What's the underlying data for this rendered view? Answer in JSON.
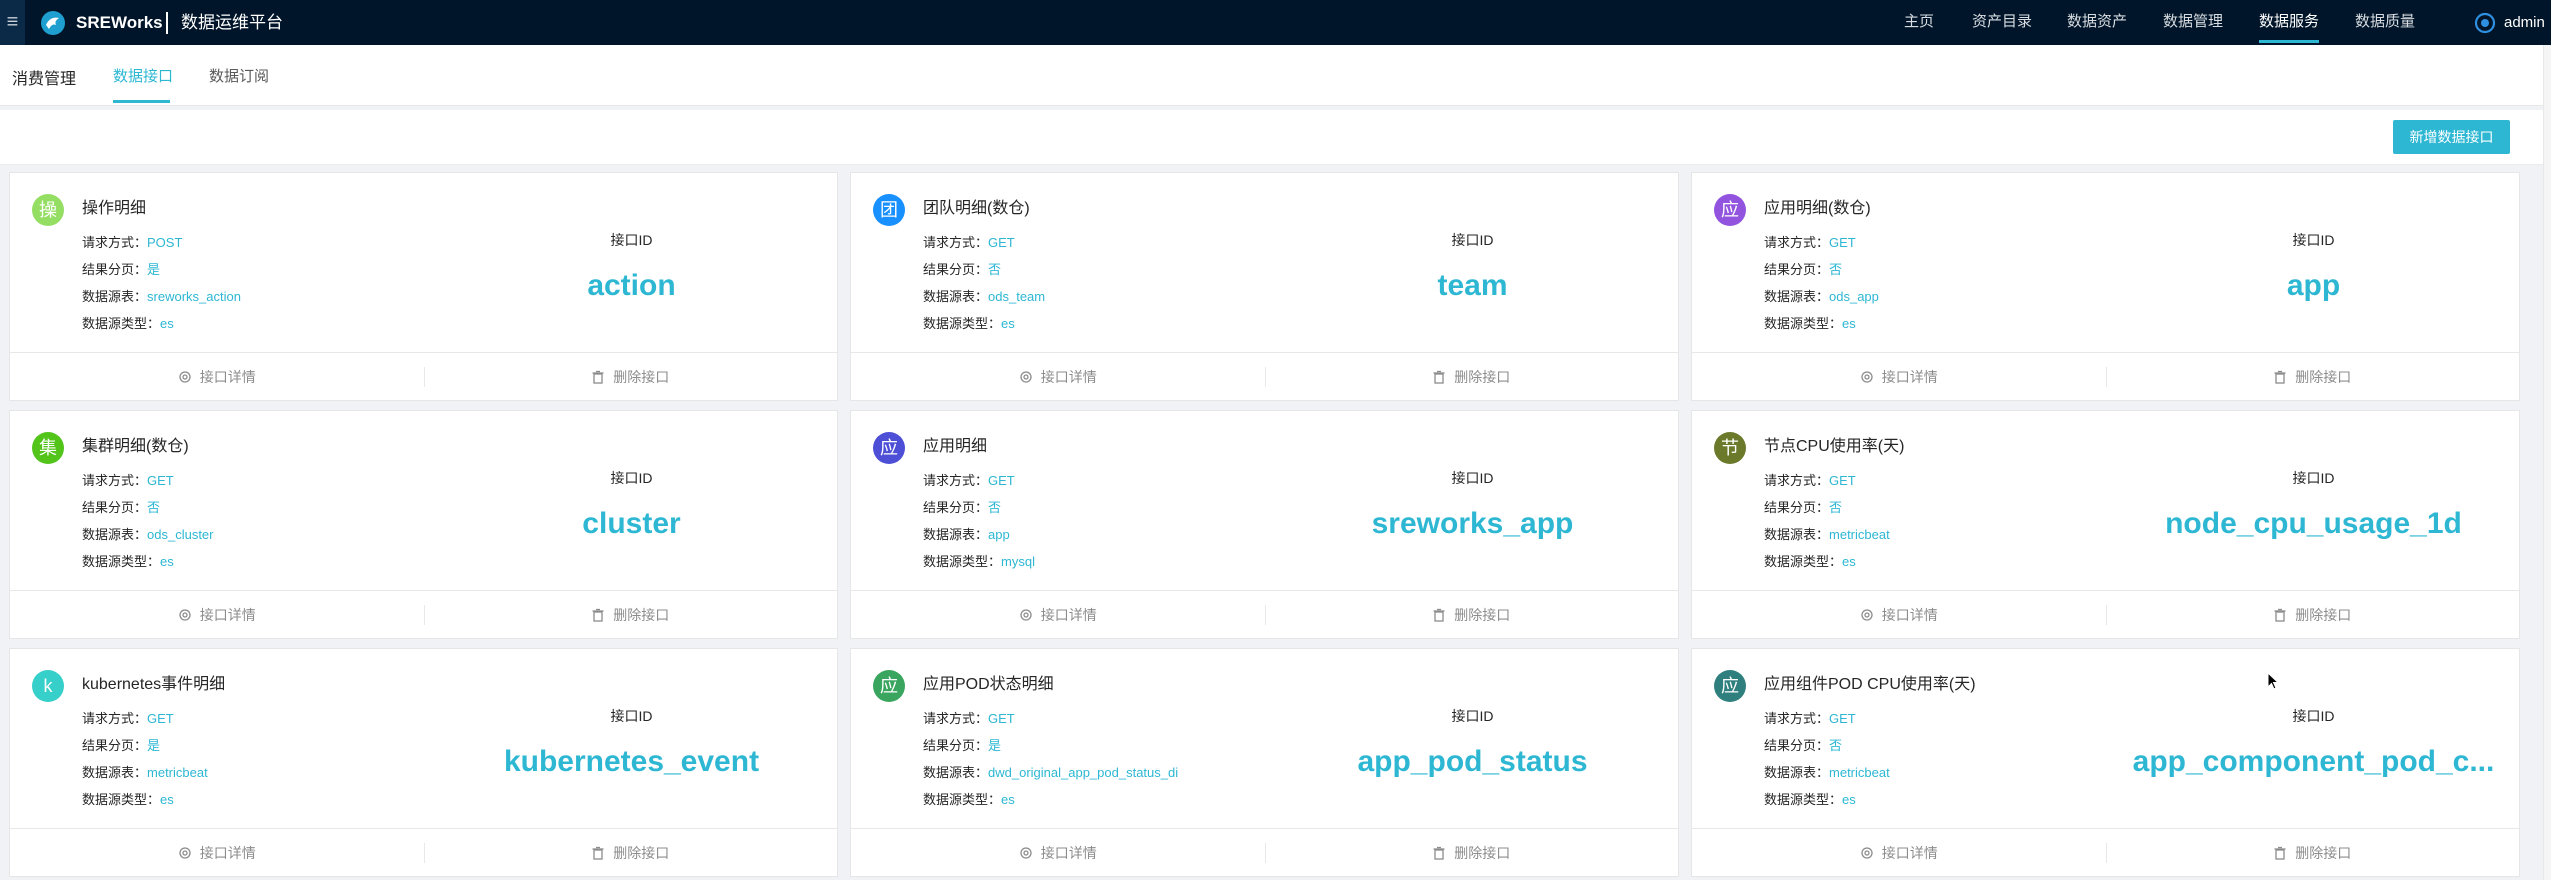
{
  "header": {
    "menu_icon": "hamburger-icon",
    "brand": "SREWorks",
    "subtitle": "数据运维平台",
    "nav": [
      "主页",
      "资产目录",
      "数据资产",
      "数据管理",
      "数据服务",
      "数据质量"
    ],
    "active_nav": "数据服务",
    "user": "admin",
    "accent_color": "#2db7d3",
    "bg_color": "#001529"
  },
  "subheader": {
    "section": "消费管理",
    "tabs": [
      "数据接口",
      "数据订阅"
    ],
    "active_tab": "数据接口"
  },
  "toolbar": {
    "add_label": "新增数据接口"
  },
  "labels": {
    "method": "请求方式：",
    "paging": "结果分页：",
    "table": "数据源表：",
    "source_type": "数据源类型：",
    "id_label": "接口ID",
    "detail": "接口详情",
    "delete": "删除接口"
  },
  "cards": [
    {
      "avatar": "操",
      "avatar_color": "#95de64",
      "title": "操作明细",
      "method": "POST",
      "paging": "是",
      "table": "sreworks_action",
      "source_type": "es",
      "id": "action"
    },
    {
      "avatar": "团",
      "avatar_color": "#1890ff",
      "title": "团队明细(数仓)",
      "method": "GET",
      "paging": "否",
      "table": "ods_team",
      "source_type": "es",
      "id": "team"
    },
    {
      "avatar": "应",
      "avatar_color": "#9254de",
      "title": "应用明细(数仓)",
      "method": "GET",
      "paging": "否",
      "table": "ods_app",
      "source_type": "es",
      "id": "app"
    },
    {
      "avatar": "集",
      "avatar_color": "#52c41a",
      "title": "集群明细(数仓)",
      "method": "GET",
      "paging": "否",
      "table": "ods_cluster",
      "source_type": "es",
      "id": "cluster"
    },
    {
      "avatar": "应",
      "avatar_color": "#4d4fd6",
      "title": "应用明细",
      "method": "GET",
      "paging": "否",
      "table": "app",
      "source_type": "mysql",
      "id": "sreworks_app"
    },
    {
      "avatar": "节",
      "avatar_color": "#6b7a2a",
      "title": "节点CPU使用率(天)",
      "method": "GET",
      "paging": "否",
      "table": "metricbeat",
      "source_type": "es",
      "id": "node_cpu_usage_1d"
    },
    {
      "avatar": "k",
      "avatar_color": "#36cfc9",
      "title": "kubernetes事件明细",
      "method": "GET",
      "paging": "是",
      "table": "metricbeat",
      "source_type": "es",
      "id": "kubernetes_event"
    },
    {
      "avatar": "应",
      "avatar_color": "#3aa55f",
      "title": "应用POD状态明细",
      "method": "GET",
      "paging": "是",
      "table": "dwd_original_app_pod_status_di",
      "source_type": "es",
      "id": "app_pod_status"
    },
    {
      "avatar": "应",
      "avatar_color": "#2f7f7f",
      "title": "应用组件POD CPU使用率(天)",
      "method": "GET",
      "paging": "否",
      "table": "metricbeat",
      "source_type": "es",
      "id": "app_component_pod_c..."
    }
  ]
}
